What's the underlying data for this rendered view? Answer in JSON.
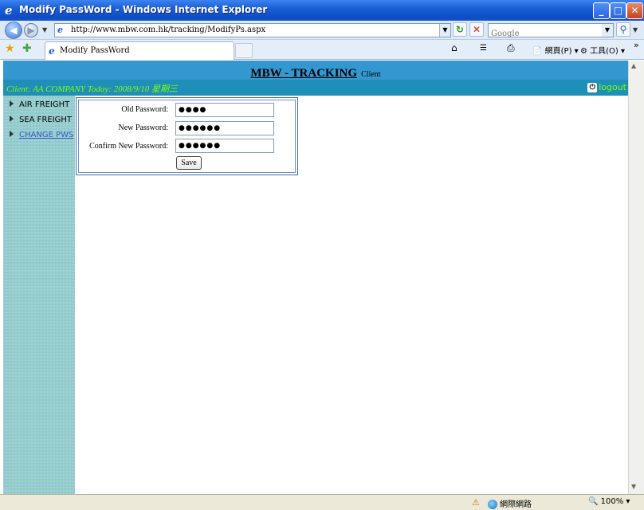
{
  "window": {
    "title": "Modify PassWord - Windows Internet Explorer",
    "minimize_glyph": "_",
    "maximize_glyph": "□",
    "close_glyph": "✕"
  },
  "browser": {
    "back_glyph": "◀",
    "forward_glyph": "▶",
    "url": "http://www.mbw.com.hk/tracking/ModifyPs.aspx",
    "search_placeholder": "Google",
    "tab_title": "Modify PassWord",
    "commands": {
      "page": "網頁(P)",
      "tools": "工具(O)"
    },
    "more_glyph": "»"
  },
  "header": {
    "brand": "MBW - TRACKING",
    "sub": "Client"
  },
  "infobar": {
    "text": "Client: AA COMPANY Today: 2008/9/10 星期三",
    "logout_label": "logout"
  },
  "sidebar": {
    "items": [
      {
        "label": "AIR FREIGHT",
        "link": false
      },
      {
        "label": "SEA FREIGHT",
        "link": false
      },
      {
        "label": "CHANGE PWS",
        "link": true
      }
    ]
  },
  "form": {
    "old_label": "Old Password:",
    "old_value": "●●●●",
    "new_label": "New Password:",
    "new_value": "●●●●●●",
    "confirm_label": "Confirm New Password:",
    "confirm_value": "●●●●●●",
    "save_label": "Save"
  },
  "statusbar": {
    "zone": "網際網路",
    "zoom": "100%"
  },
  "colors": {
    "header_bg": "#3497cf",
    "infobar_bg": "#1e8fb8",
    "info_text": "#7fff00",
    "sidebar_bg": "#9ad0d2",
    "link": "#3a55c8"
  }
}
